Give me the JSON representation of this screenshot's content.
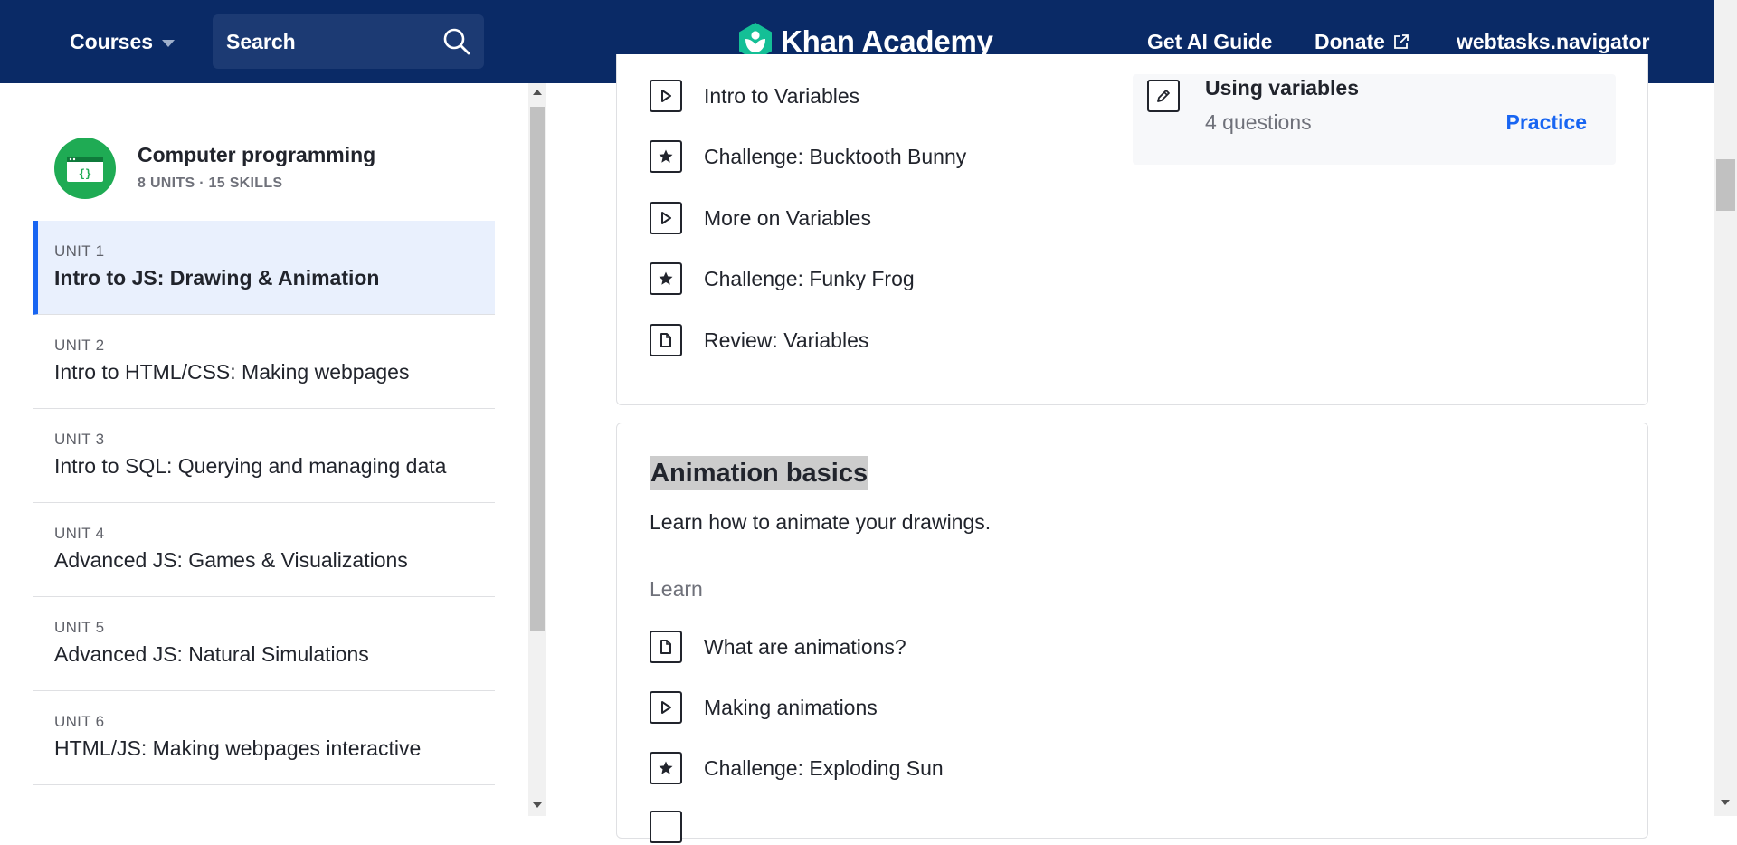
{
  "header": {
    "courses_label": "Courses",
    "search_placeholder": "Search",
    "logo_text": "Khan Academy",
    "ai_guide_label": "Get AI Guide",
    "donate_label": "Donate",
    "user_label": "webtasks.navigator"
  },
  "sidebar": {
    "course_title": "Computer programming",
    "course_meta": "8 UNITS · 15 SKILLS",
    "units": [
      {
        "label": "UNIT 1",
        "title": "Intro to JS: Drawing & Animation"
      },
      {
        "label": "UNIT 2",
        "title": "Intro to HTML/CSS: Making webpages"
      },
      {
        "label": "UNIT 3",
        "title": "Intro to SQL: Querying and managing data"
      },
      {
        "label": "UNIT 4",
        "title": "Advanced JS: Games & Visualizations"
      },
      {
        "label": "UNIT 5",
        "title": "Advanced JS: Natural Simulations"
      },
      {
        "label": "UNIT 6",
        "title": "HTML/JS: Making webpages interactive"
      }
    ]
  },
  "variables_section": {
    "items": [
      {
        "type": "video",
        "title": "Intro to Variables"
      },
      {
        "type": "challenge",
        "title": "Challenge: Bucktooth Bunny"
      },
      {
        "type": "video",
        "title": "More on Variables"
      },
      {
        "type": "challenge",
        "title": "Challenge: Funky Frog"
      },
      {
        "type": "article",
        "title": "Review: Variables"
      }
    ],
    "practice": {
      "title": "Using variables",
      "count": "4 questions",
      "link": "Practice"
    }
  },
  "animation_section": {
    "title": "Animation basics",
    "description": "Learn how to animate your drawings.",
    "learn_label": "Learn",
    "items": [
      {
        "type": "article",
        "title": "What are animations?"
      },
      {
        "type": "video",
        "title": "Making animations"
      },
      {
        "type": "challenge",
        "title": "Challenge: Exploding Sun"
      }
    ]
  },
  "colors": {
    "header_bg": "#0a2a66",
    "accent": "#1865f2",
    "course_icon": "#1fab54",
    "active_unit_bg": "#e9f0fd"
  }
}
